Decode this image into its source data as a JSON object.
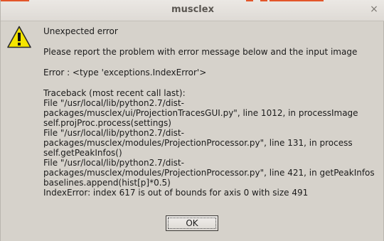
{
  "window": {
    "title": "musclex",
    "close_glyph": "×"
  },
  "icon": {
    "name": "warning-icon",
    "color": "#f5e500"
  },
  "message": {
    "heading": "Unexpected error",
    "instruction": "Please report the problem with error message below and the input image",
    "error_line": "Error : <type 'exceptions.IndexError'>",
    "traceback": [
      "Traceback (most recent call last):",
      "  File \"/usr/local/lib/python2.7/dist-",
      "packages/musclex/ui/ProjectionTracesGUI.py\", line 1012, in processImage",
      "    self.projProc.process(settings)",
      "  File \"/usr/local/lib/python2.7/dist-",
      "packages/musclex/modules/ProjectionProcessor.py\", line 131, in process",
      "    self.getPeakInfos()",
      "  File \"/usr/local/lib/python2.7/dist-",
      "packages/musclex/modules/ProjectionProcessor.py\", line 421, in getPeakInfos",
      "    baselines.append(hist[p]*0.5)",
      "IndexError: index 617 is out of bounds for axis 0 with size 491"
    ]
  },
  "buttons": {
    "ok_label": "OK"
  },
  "colors": {
    "window_bg": "#d6d2cb",
    "accent": "#e2562a"
  }
}
